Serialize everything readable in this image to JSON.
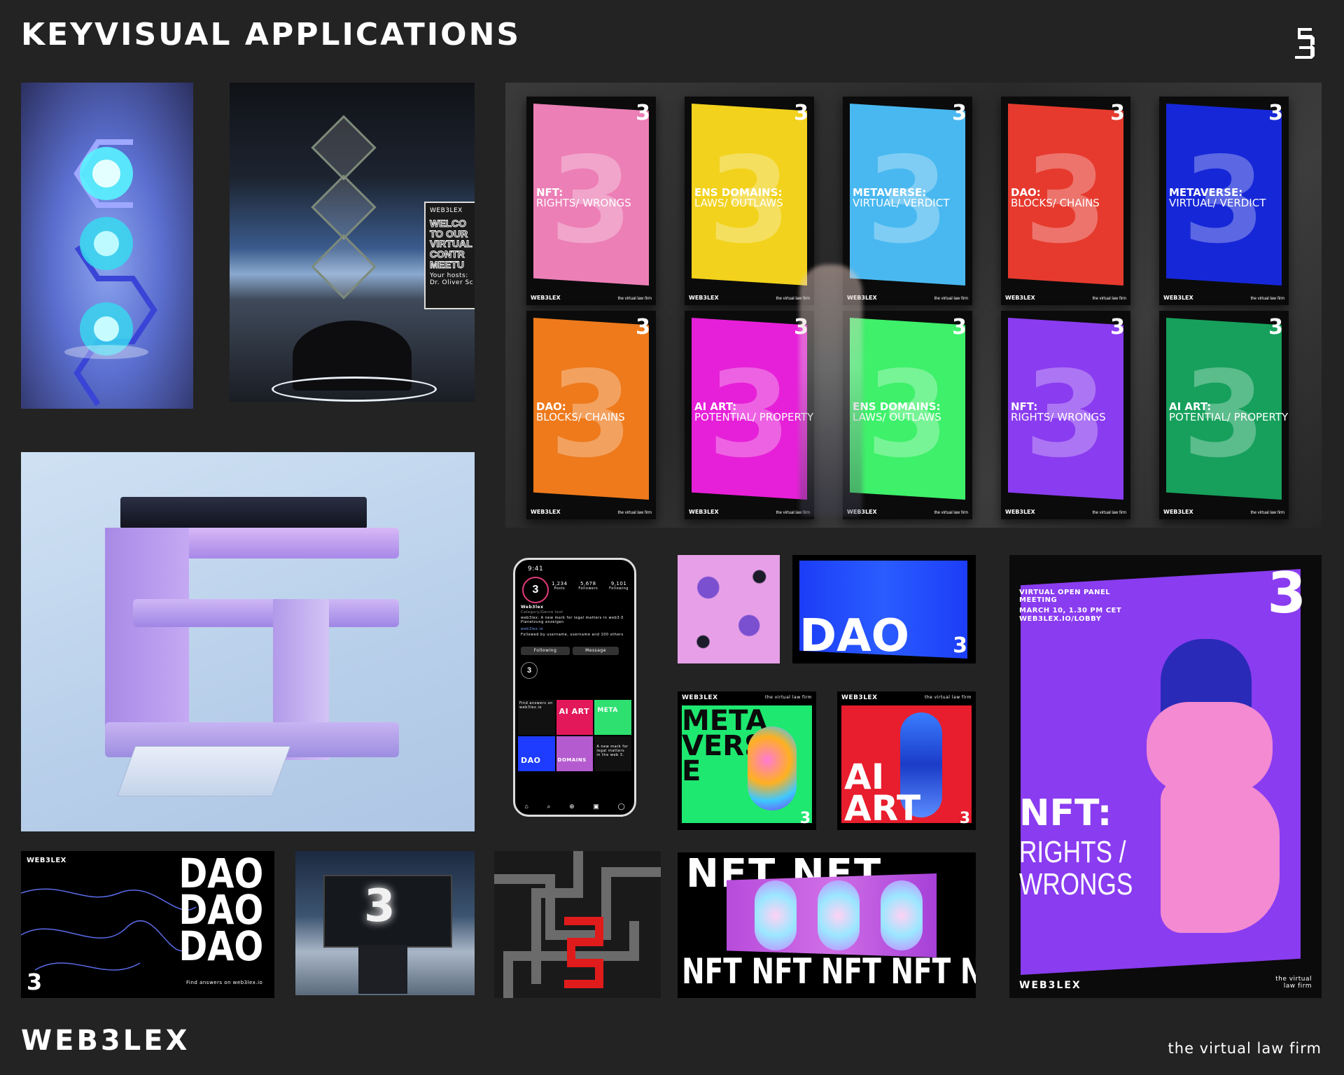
{
  "header": {
    "title": "KEYVISUAL APPLICATIONS",
    "logo_icon": "web3lex-3-logo-icon"
  },
  "footer": {
    "brand": "WEB3LEX",
    "tagline": "the virtual law firm"
  },
  "lobby_screen": {
    "brand": "WEB3LEX",
    "headline": "WELCO TO OUR VIRTUAL CONTR MEETU",
    "subline": "Your hosts: Dr. Oliver Sc"
  },
  "posters": [
    {
      "title": "NFT:",
      "sub": "RIGHTS/ WRONGS",
      "color": "#ec7fb6"
    },
    {
      "title": "ENS DOMAINS:",
      "sub": "LAWS/ OUTLAWS",
      "color": "#f2d21c"
    },
    {
      "title": "METAVERSE:",
      "sub": "VIRTUAL/ VERDICT",
      "color": "#49b8f0"
    },
    {
      "title": "DAO:",
      "sub": "BLOCKS/ CHAINS",
      "color": "#e63a2e"
    },
    {
      "title": "METAVERSE:",
      "sub": "VIRTUAL/ VERDICT",
      "color": "#1627d8"
    },
    {
      "title": "DAO:",
      "sub": "BLOCKS/ CHAINS",
      "color": "#ee7a1c"
    },
    {
      "title": "AI ART:",
      "sub": "POTENTIAL/ PROPERTY",
      "color": "#e620d8"
    },
    {
      "title": "ENS DOMAINS:",
      "sub": "LAWS/ OUTLAWS",
      "color": "#3ef06a"
    },
    {
      "title": "NFT:",
      "sub": "RIGHTS/ WRONGS",
      "color": "#8a3cf0"
    },
    {
      "title": "AI ART:",
      "sub": "POTENTIAL/ PROPERTY",
      "color": "#16a05c"
    }
  ],
  "poster_common": {
    "brand": "WEB3LEX",
    "small": "the virtual law firm",
    "meeting": "VIRTUAL OPEN PANEL MEETING"
  },
  "phone": {
    "time": "9:41",
    "stats": [
      {
        "value": "1,234",
        "label": "Posts"
      },
      {
        "value": "5,678",
        "label": "Followers"
      },
      {
        "value": "9,101",
        "label": "Following"
      }
    ],
    "name": "Web3lex",
    "category": "Category/Genre text",
    "bio": "web3lex: A new mark for legal matters in web3.0 Planetzung anzeigen",
    "link": "web3lex.io",
    "followed_by": "Followed by username, username and 100 others",
    "following_btn": "Following",
    "message_btn": "Message",
    "grid_labels": [
      "Find answers on web3lex.io",
      "AI ART",
      "META",
      "DAO",
      "DOMAINS",
      "A new mark for legal matters in the web 3."
    ]
  },
  "tiles": {
    "dao_card": "DAO",
    "meta_card": "META VERS E",
    "ai_card": "AI ART",
    "card_brand": "WEB3LEX",
    "card_small": "the virtual law firm",
    "nft_top": "NFT NFT",
    "nft_bottom": "NFT NFT NFT NFT NFT",
    "dao_stack": [
      "DAO",
      "DAO",
      "DAO"
    ],
    "dao_footer": "Find answers on web3lex.io",
    "dao_brand": "WEB3LEX"
  },
  "big_poster": {
    "meeting": "VIRTUAL OPEN PANEL MEETING",
    "date": "MARCH 10, 1.30 PM CET",
    "url": "WEB3LEX.IO/LOBBY",
    "title": "NFT:",
    "sub1": "RIGHTS /",
    "sub2": "WRONGS",
    "brand": "WEB3LEX",
    "small": "the virtual law firm"
  }
}
